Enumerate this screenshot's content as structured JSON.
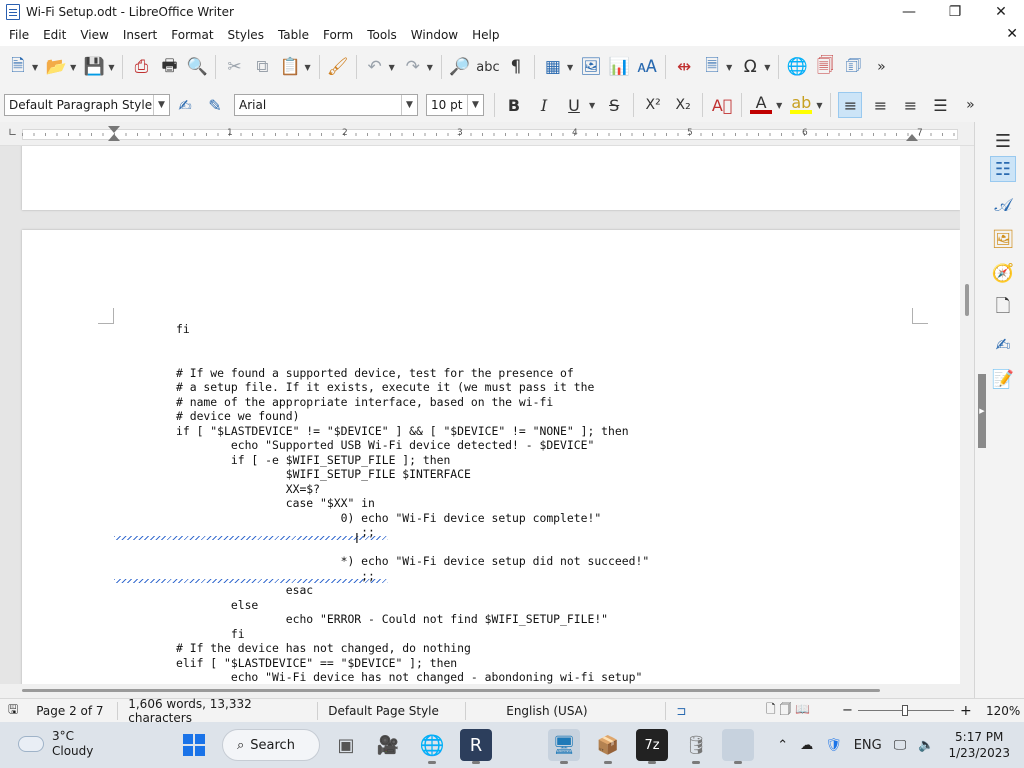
{
  "window": {
    "title": "Wi-Fi Setup.odt - LibreOffice Writer",
    "minimize": "—",
    "maximize": "❐",
    "close": "✕",
    "doc_close": "✕"
  },
  "menu": [
    "File",
    "Edit",
    "View",
    "Insert",
    "Format",
    "Styles",
    "Table",
    "Form",
    "Tools",
    "Window",
    "Help"
  ],
  "formatting": {
    "paragraph_style": "Default Paragraph Style",
    "font_name": "Arial",
    "font_size": "10 pt",
    "bold": "B",
    "italic": "I",
    "underline": "U",
    "strike": "S",
    "superscript": "X²",
    "subscript": "X₂",
    "font_color": "#c00000",
    "highlight_color": "#ffff00"
  },
  "ruler": {
    "numbers": [
      "1",
      "2",
      "3",
      "4",
      "5",
      "6",
      "7"
    ]
  },
  "document": {
    "lines": [
      "fi",
      "",
      "",
      "# If we found a supported device, test for the presence of",
      "# a setup file. If it exists, execute it (we must pass it the",
      "# name of the appropriate interface, based on the wi-fi",
      "# device we found)",
      "if [ \"$LASTDEVICE\" != \"$DEVICE\" ] && [ \"$DEVICE\" != \"NONE\" ]; then",
      "        echo \"Supported USB Wi-Fi device detected! - $DEVICE\"",
      "        if [ -e $WIFI_SETUP_FILE ]; then",
      "                $WIFI_SETUP_FILE $INTERFACE",
      "                XX=$?",
      "                case \"$XX\" in",
      "                        0) echo \"Wi-Fi device setup complete!\"",
      "                           ;;",
      "",
      "                        *) echo \"Wi-Fi device setup did not succeed!\"",
      "                           ;;",
      "                esac",
      "        else",
      "                echo \"ERROR - Could not find $WIFI_SETUP_FILE!\"",
      "        fi",
      "# If the device has not changed, do nothing",
      "elif [ \"$LASTDEVICE\" == \"$DEVICE\" ]; then",
      "        echo \"Wi-Fi device has not changed - abondoning wi-fi setup\""
    ]
  },
  "status": {
    "page": "Page 2 of 7",
    "words": "1,606 words, 13,332 characters",
    "page_style": "Default Page Style",
    "language": "English (USA)",
    "zoom": "120%"
  },
  "taskbar": {
    "temp": "3°C",
    "condition": "Cloudy",
    "search": "Search",
    "lang": "ENG",
    "time": "5:17 PM",
    "date": "1/23/2023"
  }
}
